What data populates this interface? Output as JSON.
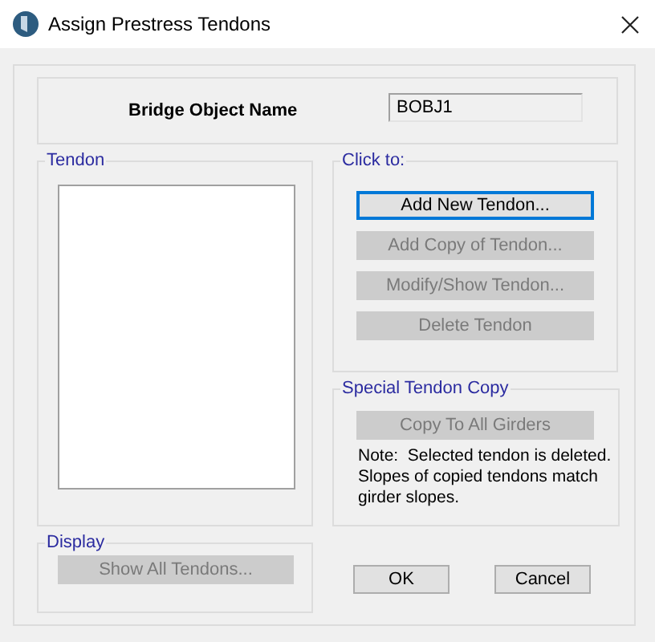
{
  "window": {
    "title": "Assign Prestress Tendons"
  },
  "bridge_object": {
    "label": "Bridge Object Name",
    "value": "BOBJ1"
  },
  "tendon_group": {
    "legend": "Tendon"
  },
  "click_to": {
    "legend": "Click to:",
    "buttons": [
      {
        "label": "Add New Tendon...",
        "disabled": false,
        "focused": true
      },
      {
        "label": "Add Copy of Tendon...",
        "disabled": true,
        "focused": false
      },
      {
        "label": "Modify/Show Tendon...",
        "disabled": true,
        "focused": false
      },
      {
        "label": "Delete Tendon",
        "disabled": true,
        "focused": false
      }
    ]
  },
  "special_copy": {
    "legend": "Special Tendon Copy",
    "button": {
      "label": "Copy To All Girders",
      "disabled": true
    },
    "note": "Note:  Selected tendon is deleted. Slopes of copied tendons match girder slopes."
  },
  "display": {
    "legend": "Display",
    "button": {
      "label": "Show All Tendons...",
      "disabled": true
    }
  },
  "dialog_buttons": [
    {
      "label": "OK",
      "disabled": false
    },
    {
      "label": "Cancel",
      "disabled": false
    }
  ]
}
